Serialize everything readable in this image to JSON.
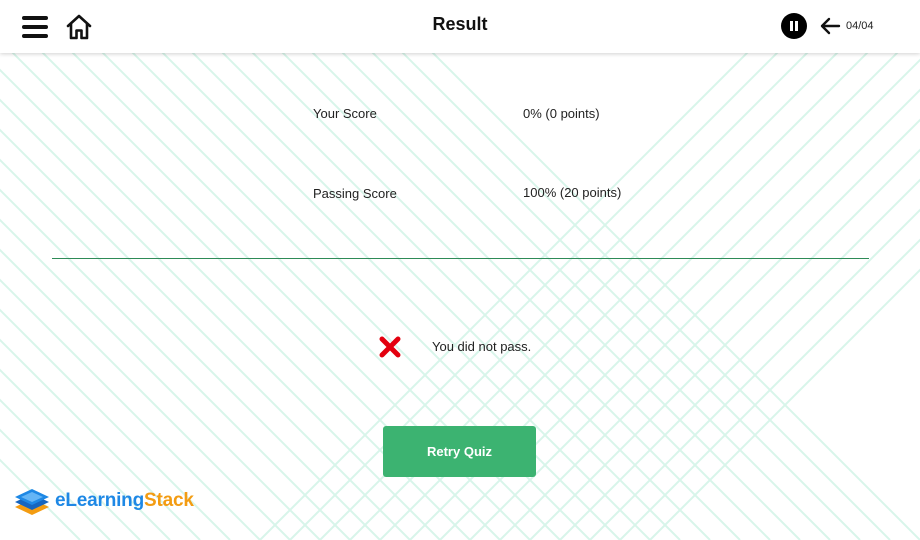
{
  "header": {
    "title": "Result",
    "page_counter": "04/04",
    "menu_icon": "hamburger-icon",
    "home_icon": "home-icon",
    "pause_icon": "pause-icon",
    "back_icon": "arrow-left-icon"
  },
  "scores": {
    "your_score_label": "Your Score",
    "your_score_value": "0% (0 points)",
    "passing_score_label": "Passing Score",
    "passing_score_value": "100% (20 points)"
  },
  "result": {
    "status_icon": "cross-icon",
    "message": "You did not pass."
  },
  "actions": {
    "retry_label": "Retry Quiz"
  },
  "brand": {
    "logo_text_part1": "eLearning",
    "logo_text_part2": "Stack"
  },
  "colors": {
    "accent_green": "#3cb371",
    "divider_green": "#2e8b57",
    "pattern_mint": "#d8f5ea",
    "fail_red": "#e3000f",
    "brand_blue": "#1e88e5",
    "brand_orange": "#f39c12"
  }
}
